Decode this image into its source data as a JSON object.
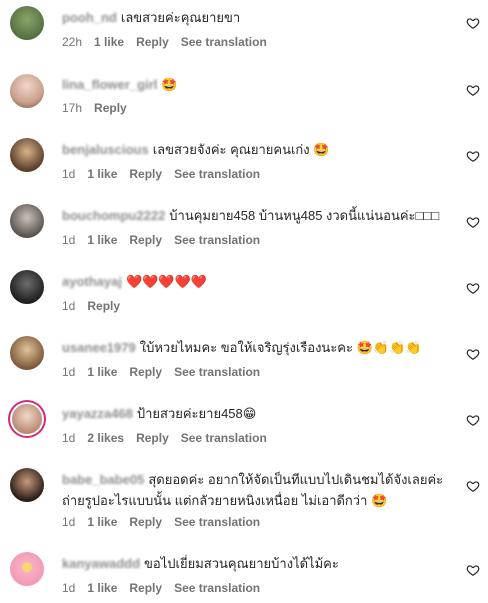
{
  "comments": [
    {
      "username": "pooh_nd",
      "text": "เลขสวยค่ะคุณยายขา",
      "time": "22h",
      "likes": "1 like",
      "reply": "Reply",
      "translate": "See translation"
    },
    {
      "username": "lina_flower_girl",
      "text": "🤩",
      "time": "17h",
      "likes": "",
      "reply": "Reply",
      "translate": ""
    },
    {
      "username": "benjaluscious",
      "text": "เลขสวยจังค่ะ คุณยายคนเก่ง 🤩",
      "time": "1d",
      "likes": "1 like",
      "reply": "Reply",
      "translate": "See translation"
    },
    {
      "username": "bouchompu2222",
      "text": "บ้านคุมยาย458 บ้านหนู485 งวดนี้แน่นอนค่ะ□□□",
      "time": "1d",
      "likes": "1 like",
      "reply": "Reply",
      "translate": "See translation"
    },
    {
      "username": "ayothayaj",
      "text": "❤️❤️❤️❤️❤️",
      "time": "1d",
      "likes": "",
      "reply": "Reply",
      "translate": ""
    },
    {
      "username": "usanee1979",
      "text": "ใบ้หวยไหมคะ ขอให้เจริญรุ่งเรืองนะคะ 🤩👏👏👏",
      "time": "1d",
      "likes": "1 like",
      "reply": "Reply",
      "translate": "See translation"
    },
    {
      "username": "yayazza468",
      "text": "ป้ายสวยค่ะยาย458😁",
      "time": "1d",
      "likes": "2 likes",
      "reply": "Reply",
      "translate": "See translation"
    },
    {
      "username": "babe_babe05",
      "text": "สุดยอดค่ะ อยากให้จัดเป็นทีแบบไปเดินชมได้จังเลยค่ะ ถ่ายรูปอะไรแบบนั้น แต่กลัวยายหนิงเหนื่อย ไม่เอาดีกว่า 🤩",
      "time": "1d",
      "likes": "1 like",
      "reply": "Reply",
      "translate": "See translation"
    },
    {
      "username": "kanyawaddd",
      "text": "ขอไปเยี่ยมสวนคุณยายบ้างได้ไม้คะ",
      "time": "1d",
      "likes": "1 like",
      "reply": "Reply",
      "translate": "See translation"
    }
  ],
  "colors": {
    "meta": "#737373",
    "text": "#262626",
    "story_ring": "#d62976"
  }
}
